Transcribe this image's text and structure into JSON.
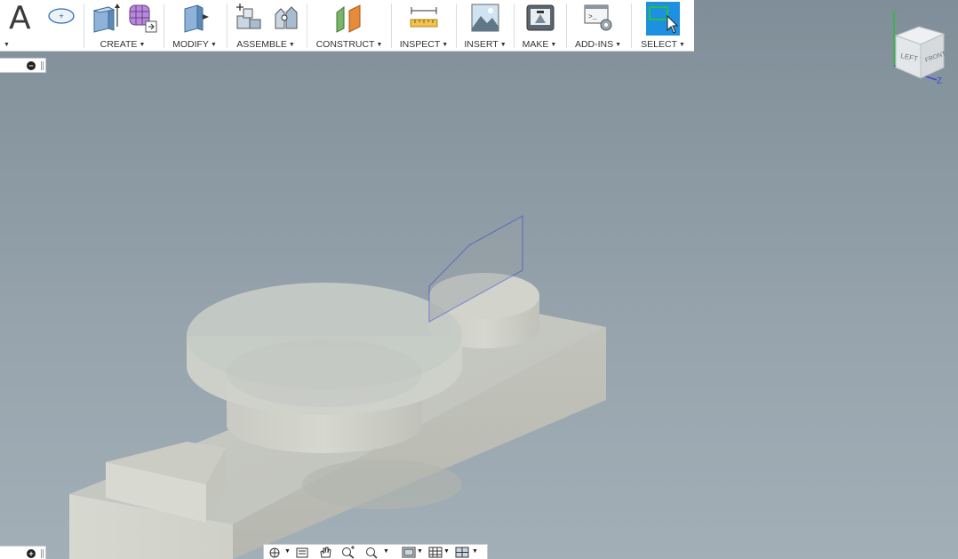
{
  "toolbar": {
    "groups": [
      {
        "label": "CREATE"
      },
      {
        "label": "MODIFY"
      },
      {
        "label": "ASSEMBLE"
      },
      {
        "label": "CONSTRUCT"
      },
      {
        "label": "INSPECT"
      },
      {
        "label": "INSERT"
      },
      {
        "label": "MAKE"
      },
      {
        "label": "ADD-INS"
      },
      {
        "label": "SELECT"
      }
    ],
    "text_tool_glyph": "A"
  },
  "viewcube": {
    "face_left": "LEFT",
    "face_front": "FRONT",
    "axis_y": "Y",
    "axis_z": "Z"
  },
  "colors": {
    "viewport_top": "#7f8e98",
    "viewport_bottom": "#a3afb7",
    "part_face": "#d3d5cc",
    "select_accent": "#1e90e0",
    "sketch_plane_edge": "#2a3bd6"
  }
}
